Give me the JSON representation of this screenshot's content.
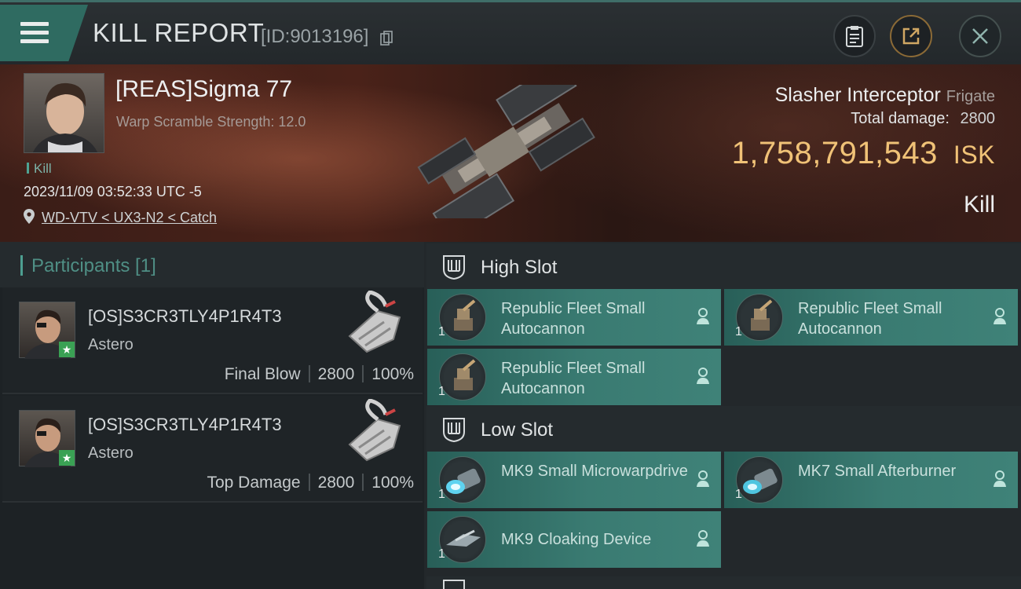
{
  "header": {
    "title": "KILL REPORT",
    "report_id": "[ID:9013196]",
    "icons": [
      "menu-icon",
      "copy-icon",
      "clipboard-icon",
      "share-icon",
      "close-icon"
    ]
  },
  "victim": {
    "name": "[REAS]Sigma 77",
    "subtitle": "Warp Scramble Strength: 12.0",
    "tag": "Kill",
    "datetime": "2023/11/09 03:52:33 UTC -5",
    "location": "WD-VTV < UX3-N2 < Catch",
    "ship_name": "Slasher Interceptor",
    "ship_class": "Frigate",
    "total_damage_label": "Total damage:",
    "total_damage": "2800",
    "isk_value": "1,758,791,543",
    "isk_unit": "ISK",
    "result": "Kill"
  },
  "participants": {
    "title": "Participants [1]",
    "rows": [
      {
        "name": "[OS]S3CR3TLY4P1R4T3",
        "ship": "Astero",
        "role": "Final Blow",
        "damage": "2800",
        "percent": "100%"
      },
      {
        "name": "[OS]S3CR3TLY4P1R4T3",
        "ship": "Astero",
        "role": "Top Damage",
        "damage": "2800",
        "percent": "100%"
      }
    ]
  },
  "slots": {
    "high": {
      "title": "High Slot",
      "modules": [
        {
          "name": "Republic Fleet Small Autocannon",
          "qty": "1"
        },
        {
          "name": "Republic Fleet Small Autocannon",
          "qty": "1"
        },
        {
          "name": "Republic Fleet Small Autocannon",
          "qty": "1"
        }
      ]
    },
    "low": {
      "title": "Low Slot",
      "modules": [
        {
          "name": "MK9 Small Microwarpdrive",
          "qty": "1"
        },
        {
          "name": "MK7 Small Afterburner",
          "qty": "1"
        },
        {
          "name": "MK9 Cloaking Device",
          "qty": "1"
        }
      ]
    }
  },
  "colors": {
    "accent_teal": "#2f6b61",
    "module_teal": "#3a7b72",
    "isk_gold": "#f0c277",
    "star_green": "#3aa154"
  }
}
